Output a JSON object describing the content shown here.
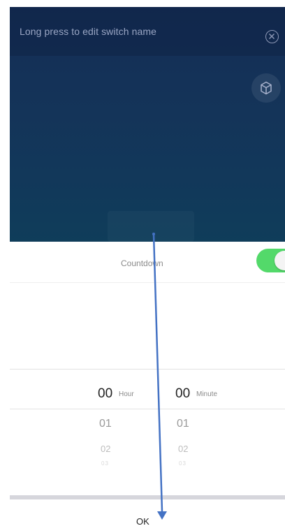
{
  "header": {
    "hint": "Long press to edit switch name"
  },
  "icons": {
    "close": "close-circle-icon",
    "cube": "cube-icon"
  },
  "countdown": {
    "label": "Countdown",
    "enabled": true,
    "toggle_color": "#53d96a"
  },
  "picker": {
    "hour": {
      "selected": "00",
      "unit": "Hour",
      "next": "01",
      "next2": "02",
      "next3": "03"
    },
    "minute": {
      "selected": "00",
      "unit": "Minute",
      "next": "01",
      "next2": "02",
      "next3": "03"
    }
  },
  "footer": {
    "ok_label": "OK"
  },
  "colors": {
    "panel_top": "#142d55",
    "panel_bottom": "#0f3d5a",
    "annotation_arrow": "#4472c4"
  }
}
